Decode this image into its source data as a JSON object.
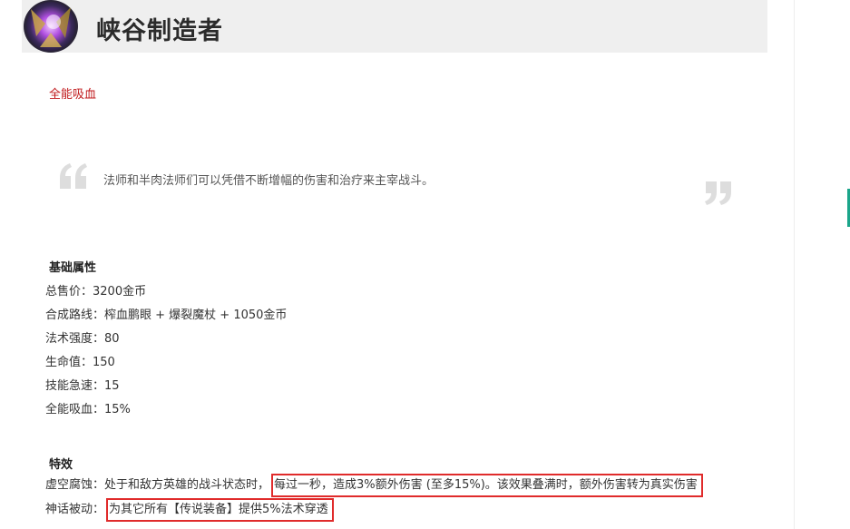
{
  "header": {
    "title": "峡谷制造者"
  },
  "item_link": {
    "label": "全能吸血"
  },
  "quote": {
    "text": "法师和半肉法师们可以凭借不断增幅的伤害和治疗来主宰战斗。"
  },
  "attributes": {
    "heading": "基础属性",
    "lines": [
      "总售价：3200金币",
      "合成路线：榨血鹏眼 + 爆裂魔杖 + 1050金币",
      "法术强度：80",
      "生命值：150",
      "技能急速：15",
      "全能吸血：15%"
    ]
  },
  "effects": {
    "heading": "特效",
    "items": [
      {
        "prefix": "虚空腐蚀：处于和敌方英雄的战斗状态时，",
        "highlight": "每过一秒，造成3%额外伤害 (至多15%)。该效果叠满时，额外伤害转为真实伤害"
      },
      {
        "prefix": "神话被动：",
        "highlight": "为其它所有【传说装备】提供5%法术穿透"
      }
    ]
  },
  "colors": {
    "link_red": "#c0181b",
    "highlight_border": "#e02b2b",
    "header_bg": "#efefef",
    "accent_green": "#1aa58a"
  }
}
